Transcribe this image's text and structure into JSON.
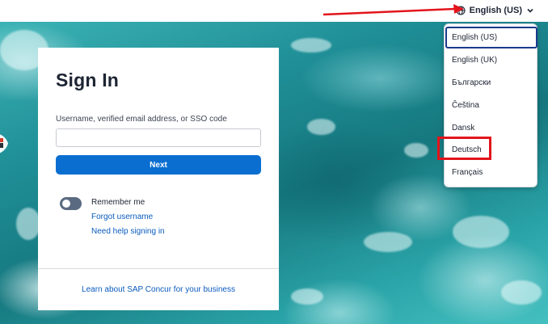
{
  "language_selector": {
    "current": "English (US)",
    "options": [
      {
        "label": "English (US)",
        "selected": true
      },
      {
        "label": "English (UK)",
        "selected": false
      },
      {
        "label": "Български",
        "selected": false
      },
      {
        "label": "Čeština",
        "selected": false
      },
      {
        "label": "Dansk",
        "selected": false
      },
      {
        "label": "Deutsch",
        "selected": false
      },
      {
        "label": "Français",
        "selected": false
      }
    ]
  },
  "signin": {
    "title": "Sign In",
    "username_label": "Username, verified email address, or SSO code",
    "username_value": "",
    "username_placeholder": "",
    "next_label": "Next",
    "remember_label": "Remember me",
    "remember_on": false,
    "forgot_label": "Forgot username",
    "help_label": "Need help signing in",
    "learn_label": "Learn about SAP Concur for your business"
  },
  "icons": {
    "globe": "globe-icon",
    "chevron": "chevron-down-icon"
  },
  "colors": {
    "primary_button": "#0a6ed1",
    "link": "#0a5bbf",
    "annotation_red": "#e3141c",
    "selected_outline": "#1b3a8c",
    "toggle_off": "#5a6a80"
  }
}
